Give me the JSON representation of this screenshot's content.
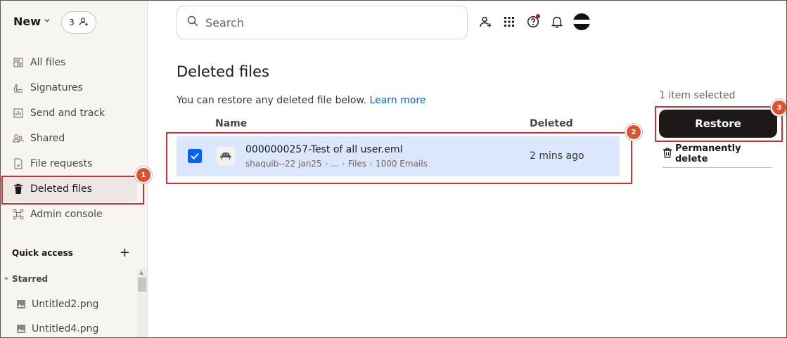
{
  "sidebar": {
    "new_label": "New",
    "invite_count": "3",
    "items": [
      {
        "label": "All files",
        "icon": "all-files-icon"
      },
      {
        "label": "Signatures",
        "icon": "signature-icon"
      },
      {
        "label": "Send and track",
        "icon": "chart-icon"
      },
      {
        "label": "Shared",
        "icon": "shared-icon"
      },
      {
        "label": "File requests",
        "icon": "file-request-icon"
      },
      {
        "label": "Deleted files",
        "icon": "trash-icon",
        "active": true
      },
      {
        "label": "Admin console",
        "icon": "admin-icon"
      }
    ],
    "quick_access": "Quick access",
    "starred": "Starred",
    "starred_files": [
      "Untitled2.png",
      "Untitled4.png"
    ]
  },
  "topbar": {
    "search_placeholder": "Search"
  },
  "main": {
    "title": "Deleted files",
    "subtitle": "You can restore any deleted file below.",
    "learn_more": "Learn more",
    "col_name": "Name",
    "col_deleted": "Deleted",
    "rows": [
      {
        "name": "0000000257-Test of all user.eml",
        "path": [
          "shaquib--22 jan25",
          "...",
          "Files",
          "1000 Emails"
        ],
        "deleted": "2 mins ago",
        "checked": true
      }
    ]
  },
  "actions": {
    "selected": "1 item selected",
    "restore": "Restore",
    "permanently_delete": "Permanently delete"
  },
  "annotations": [
    "1",
    "2",
    "3"
  ],
  "colors": {
    "accent": "#0061fe",
    "row_selected": "#dbe7fc",
    "annotation": "#d32f2f",
    "primary_button": "#1e1919"
  }
}
